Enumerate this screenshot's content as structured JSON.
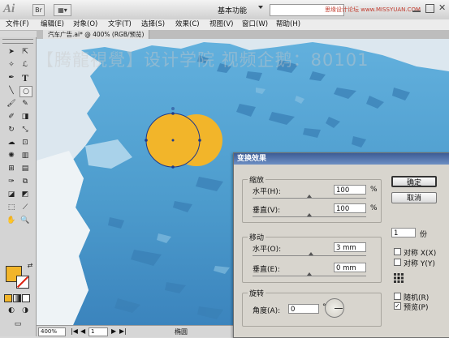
{
  "app": {
    "logo": "Ai",
    "workspace": "基本功能",
    "watermark": "思缘设计论坛 www.MISSYUAN.COM"
  },
  "menu": [
    "文件(F)",
    "编辑(E)",
    "对象(O)",
    "文字(T)",
    "选择(S)",
    "效果(C)",
    "视图(V)",
    "窗口(W)",
    "帮助(H)"
  ],
  "document": {
    "tab_label": "汽车广告.ai* @ 400% (RGB/预览)",
    "canvas_watermark": "【腾龍視覺】设计学院 视频企鹅：80101"
  },
  "status": {
    "zoom": "400%",
    "page": "1",
    "tool": "椭圆"
  },
  "colors": {
    "fill": "#f2b52a",
    "sky": "#4d9ccd",
    "dialog_title": "#3d5d96"
  },
  "dialog": {
    "title": "变换效果",
    "scale": {
      "label": "缩放",
      "horizontal_label": "水平(H):",
      "horizontal_value": "100",
      "vertical_label": "垂直(V):",
      "vertical_value": "100",
      "unit": "%"
    },
    "move": {
      "label": "移动",
      "horizontal_label": "水平(O):",
      "horizontal_value": "3 mm",
      "vertical_label": "垂直(E):",
      "vertical_value": "0 mm"
    },
    "rotate": {
      "label": "旋转",
      "angle_label": "角度(A):",
      "angle_value": "0",
      "angle_unit": "°"
    },
    "buttons": {
      "ok": "确定",
      "cancel": "取消"
    },
    "copies": {
      "value": "1",
      "unit": "份"
    },
    "checkboxes": [
      {
        "label": "对称 X(X)",
        "checked": false
      },
      {
        "label": "对称 Y(Y)",
        "checked": false
      },
      {
        "label": "随机(R)",
        "checked": false
      },
      {
        "label": "预览(P)",
        "checked": true
      }
    ]
  }
}
